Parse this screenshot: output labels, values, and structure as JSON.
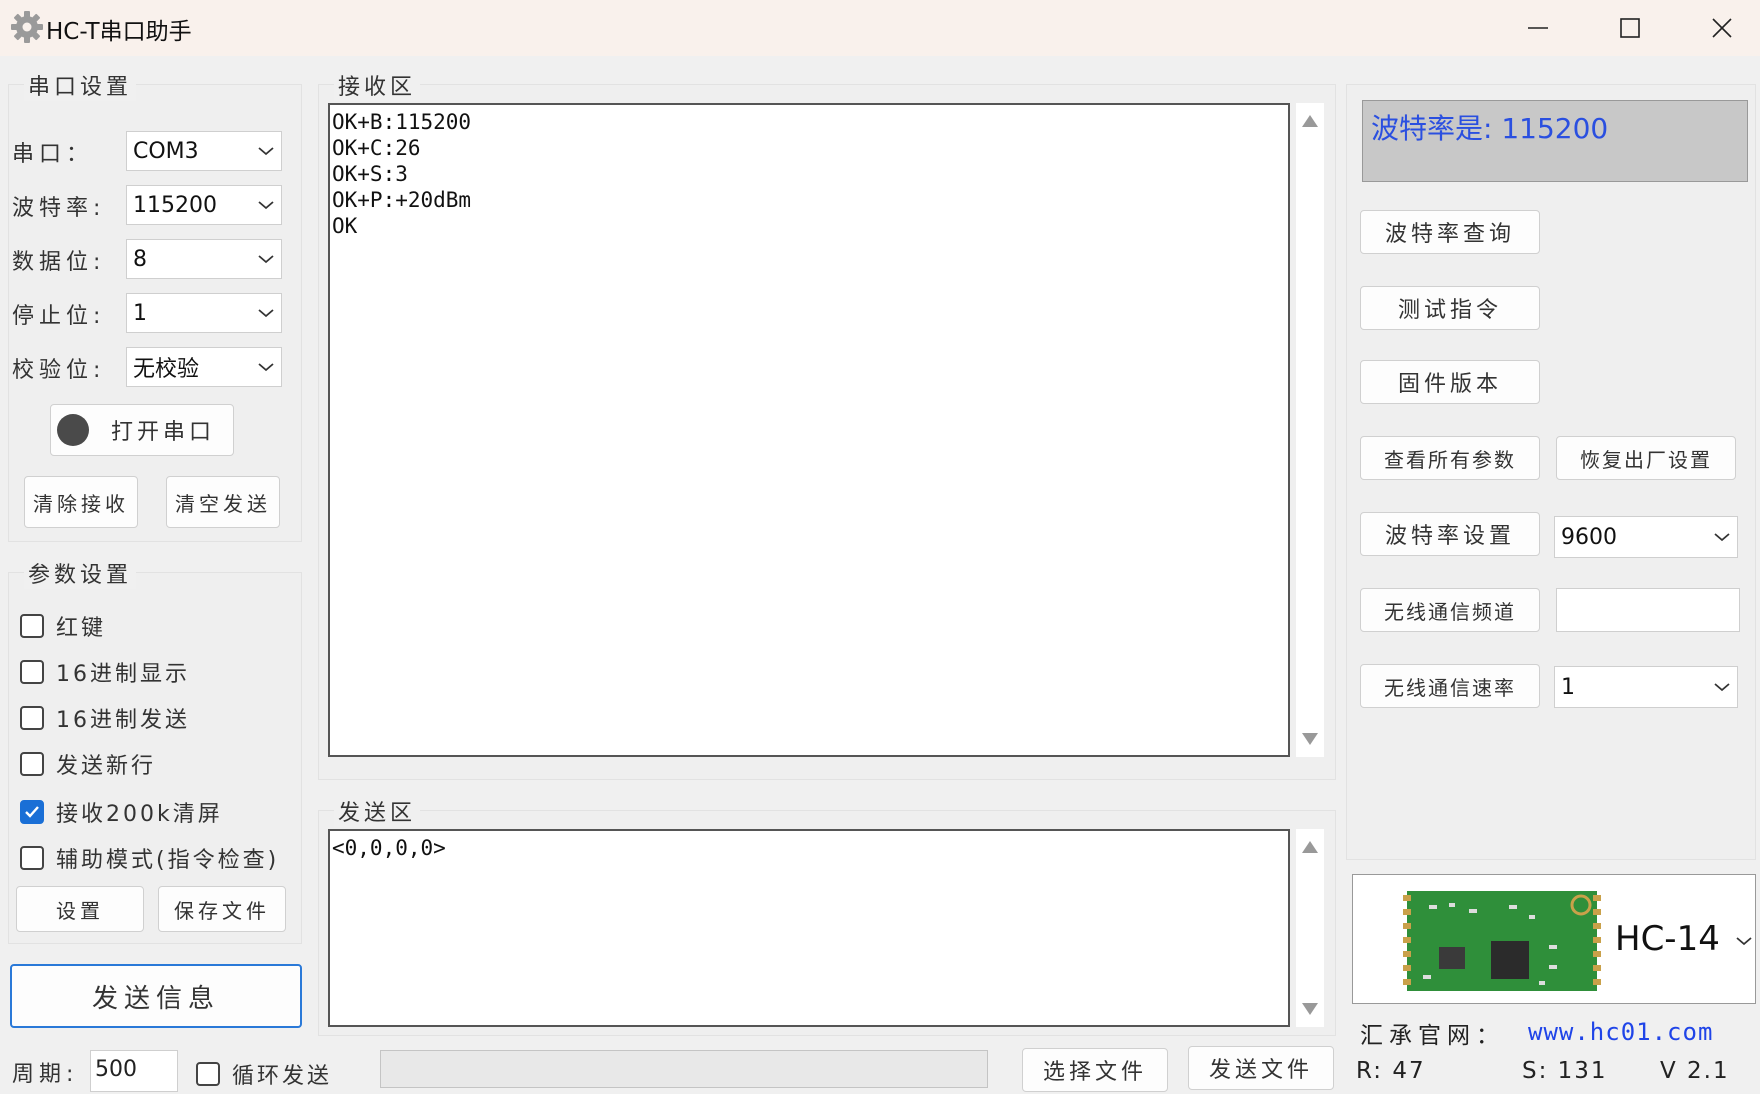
{
  "window": {
    "title": "HC-T串口助手"
  },
  "serial_settings": {
    "group_label": "串口设置",
    "port_label": "串口：",
    "port_value": "COM3",
    "baud_label": "波特率:",
    "baud_value": "115200",
    "data_bits_label": "数据位:",
    "data_bits_value": "8",
    "stop_bits_label": "停止位:",
    "stop_bits_value": "1",
    "parity_label": "校验位:",
    "parity_value": "无校验",
    "open_button": "打开串口",
    "clear_receive_button": "清除接收",
    "clear_send_button": "清空发送"
  },
  "param_settings": {
    "group_label": "参数设置",
    "checkboxes": [
      {
        "label": "红键",
        "checked": false
      },
      {
        "label": "16进制显示",
        "checked": false
      },
      {
        "label": "16进制发送",
        "checked": false
      },
      {
        "label": "发送新行",
        "checked": false
      },
      {
        "label": "接收200k清屏",
        "checked": true
      },
      {
        "label": "辅助模式(指令检查)",
        "checked": false
      }
    ],
    "settings_button": "设置",
    "save_file_button": "保存文件",
    "send_info_button": "发送信息"
  },
  "receive_area": {
    "label": "接收区",
    "lines": [
      "OK+B:115200",
      "OK+C:26",
      "OK+S:3",
      "OK+P:+20dBm",
      "OK"
    ]
  },
  "send_area": {
    "label": "发送区",
    "lines": [
      "<0,0,0,0>"
    ]
  },
  "right_panel": {
    "baud_display": "波特率是: 115200",
    "baud_query_button": "波特率查询",
    "test_command_button": "测试指令",
    "firmware_version_button": "固件版本",
    "view_all_params_button": "查看所有参数",
    "factory_reset_button": "恢复出厂设置",
    "baud_set_button": "波特率设置",
    "baud_set_value": "9600",
    "wireless_channel_button": "无线通信频道",
    "wireless_channel_value": "",
    "wireless_rate_button": "无线通信速率",
    "wireless_rate_value": "1",
    "module_name": "HC-14"
  },
  "footer": {
    "period_label": "周期:",
    "period_value": "500",
    "loop_send_label": "循环发送",
    "loop_send_checked": false,
    "select_file_button": "选择文件",
    "send_file_button": "发送文件",
    "official_site_label": "汇承官网：",
    "official_site_url": "www.hc01.com",
    "received_count": "R: 47",
    "sent_count": "S: 131",
    "version": "V 2.1"
  },
  "colors": {
    "accent": "#1a6fd6",
    "link": "#1f44e8",
    "baud_display_text": "#2a4fe0",
    "status_led": "#4a4a4a"
  }
}
